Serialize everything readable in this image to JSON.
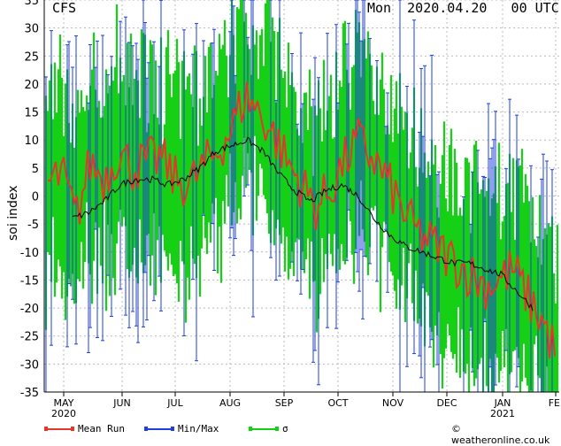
{
  "header": {
    "model": "CFS",
    "run": "Mon  2020.04.20   00 UTC"
  },
  "chart_data": {
    "type": "line",
    "ylabel": "soi index",
    "ylim": [
      -35,
      35
    ],
    "yticks": [
      -35,
      -30,
      -25,
      -20,
      -15,
      -10,
      -5,
      0,
      5,
      10,
      15,
      20,
      25,
      30,
      35
    ],
    "grid": true,
    "x_months": [
      {
        "label": "MAY",
        "sub": "2020"
      },
      {
        "label": "JUN",
        "sub": ""
      },
      {
        "label": "JUL",
        "sub": ""
      },
      {
        "label": "AUG",
        "sub": ""
      },
      {
        "label": "SEP",
        "sub": ""
      },
      {
        "label": "OCT",
        "sub": ""
      },
      {
        "label": "NOV",
        "sub": ""
      },
      {
        "label": "DEC",
        "sub": ""
      },
      {
        "label": "JAN",
        "sub": "2021"
      },
      {
        "label": "FEI",
        "sub": ""
      }
    ],
    "series": [
      {
        "name": "Mean Run",
        "color": "#e0392b",
        "values": [
          2,
          4,
          -4,
          6,
          3,
          8,
          5,
          6,
          7,
          3,
          2,
          5,
          8,
          12,
          18,
          15,
          11,
          6,
          2,
          -2,
          1,
          6,
          10,
          7,
          3,
          -2,
          -6,
          -8,
          -10,
          -12,
          -14,
          -16,
          -15,
          -13,
          -18,
          -22,
          -28
        ]
      },
      {
        "name": "Min/Max",
        "color": "#1f3fe0"
      },
      {
        "name": "σ",
        "color": "#16d016"
      },
      {
        "name": "",
        "color": "#000000",
        "values": [
          -4,
          -3,
          -1,
          2,
          3,
          3,
          2,
          3,
          5,
          8,
          9,
          10,
          8,
          4,
          1,
          -1,
          1,
          2,
          0,
          -4,
          -7,
          -9,
          -10,
          -11,
          -12,
          -12,
          -13,
          -14,
          -17,
          -20
        ]
      }
    ]
  },
  "legend": [
    {
      "label": "Mean Run",
      "color": "#e0392b"
    },
    {
      "label": "Min/Max",
      "color": "#1f3fe0"
    },
    {
      "label": "σ",
      "color": "#16d016"
    }
  ],
  "credit": "© weatheronline.co.uk"
}
